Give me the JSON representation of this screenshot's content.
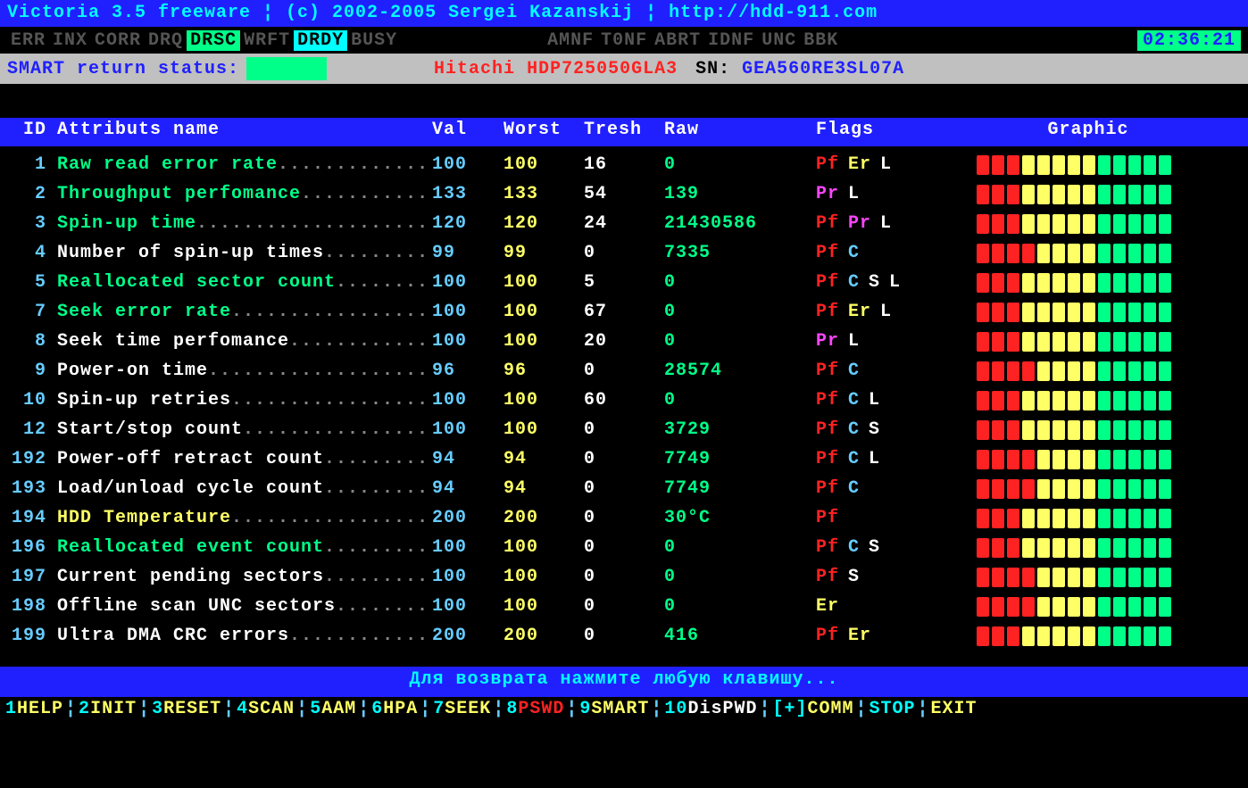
{
  "title": "Victoria 3.5 freeware  ¦  (c) 2002-2005  Sergei Kazanskij ¦ http://hdd-911.com",
  "flags_row": {
    "items": [
      "ERR",
      "INX",
      "CORR",
      "DRQ",
      "DRSC",
      "WRFT",
      "DRDY",
      "BUSY"
    ],
    "right_items": [
      "AMNF",
      "T0NF",
      "ABRT",
      "IDNF",
      "UNC",
      "BBK"
    ],
    "clock": "02:36:21"
  },
  "info": {
    "smart_label": "SMART return status:",
    "model": "Hitachi HDP725050GLA3",
    "sn_label": "SN:",
    "serial": "GEA560RE3SL07A"
  },
  "headers": {
    "id": "ID",
    "name": "Attributs name",
    "val": "Val",
    "worst": "Worst",
    "tresh": "Tresh",
    "raw": "Raw",
    "flags": "Flags",
    "graphic": "Graphic"
  },
  "rows": [
    {
      "id": "1",
      "name": "Raw read error rate",
      "style": "green",
      "val": "100",
      "worst": "100",
      "tresh": "16",
      "raw": "0",
      "flags": [
        [
          "Pf",
          "f-pf"
        ],
        [
          "Er",
          "f-er"
        ],
        [
          "L",
          "f-l"
        ]
      ],
      "bars": "rrryyyyyggggg"
    },
    {
      "id": "2",
      "name": "Throughput perfomance",
      "style": "green",
      "val": "133",
      "worst": "133",
      "tresh": "54",
      "raw": "139",
      "flags": [
        [
          "Pr",
          "f-pr"
        ],
        [
          "L",
          "f-l"
        ]
      ],
      "bars": "rrryyyyyggggg"
    },
    {
      "id": "3",
      "name": "Spin-up time",
      "style": "green",
      "val": "120",
      "worst": "120",
      "tresh": "24",
      "raw": "21430586",
      "flags": [
        [
          "Pf",
          "f-pf"
        ],
        [
          "Pr",
          "f-pr"
        ],
        [
          "L",
          "f-l"
        ]
      ],
      "bars": "rrryyyyyggggg"
    },
    {
      "id": "4",
      "name": "Number of spin-up times",
      "style": "white",
      "val": "99",
      "worst": "99",
      "tresh": "0",
      "raw": "7335",
      "flags": [
        [
          "Pf",
          "f-pf"
        ],
        [
          "C",
          "f-c"
        ]
      ],
      "bars": "rrrryyyyggggg"
    },
    {
      "id": "5",
      "name": "Reallocated sector count",
      "style": "green",
      "val": "100",
      "worst": "100",
      "tresh": "5",
      "raw": "0",
      "flags": [
        [
          "Pf",
          "f-pf"
        ],
        [
          "C",
          "f-c"
        ],
        [
          "S",
          "f-s"
        ],
        [
          "L",
          "f-l"
        ]
      ],
      "bars": "rrryyyyyggggg"
    },
    {
      "id": "7",
      "name": "Seek error rate",
      "style": "green",
      "val": "100",
      "worst": "100",
      "tresh": "67",
      "raw": "0",
      "flags": [
        [
          "Pf",
          "f-pf"
        ],
        [
          "Er",
          "f-er"
        ],
        [
          "L",
          "f-l"
        ]
      ],
      "bars": "rrryyyyyggggg"
    },
    {
      "id": "8",
      "name": "Seek time perfomance",
      "style": "white",
      "val": "100",
      "worst": "100",
      "tresh": "20",
      "raw": "0",
      "flags": [
        [
          "Pr",
          "f-pr"
        ],
        [
          "L",
          "f-l"
        ]
      ],
      "bars": "rrryyyyyggggg"
    },
    {
      "id": "9",
      "name": "Power-on time",
      "style": "white",
      "val": "96",
      "worst": "96",
      "tresh": "0",
      "raw": "28574",
      "flags": [
        [
          "Pf",
          "f-pf"
        ],
        [
          "C",
          "f-c"
        ]
      ],
      "bars": "rrrryyyyggggg"
    },
    {
      "id": "10",
      "name": "Spin-up retries",
      "style": "white",
      "val": "100",
      "worst": "100",
      "tresh": "60",
      "raw": "0",
      "flags": [
        [
          "Pf",
          "f-pf"
        ],
        [
          "C",
          "f-c"
        ],
        [
          "L",
          "f-l"
        ]
      ],
      "bars": "rrryyyyyggggg"
    },
    {
      "id": "12",
      "name": "Start/stop count",
      "style": "white",
      "val": "100",
      "worst": "100",
      "tresh": "0",
      "raw": "3729",
      "flags": [
        [
          "Pf",
          "f-pf"
        ],
        [
          "C",
          "f-c"
        ],
        [
          "S",
          "f-s"
        ]
      ],
      "bars": "rrryyyyyggggg"
    },
    {
      "id": "192",
      "name": "Power-off retract count",
      "style": "white",
      "val": "94",
      "worst": "94",
      "tresh": "0",
      "raw": "7749",
      "flags": [
        [
          "Pf",
          "f-pf"
        ],
        [
          "C",
          "f-c"
        ],
        [
          "L",
          "f-l"
        ]
      ],
      "bars": "rrrryyyyggggg"
    },
    {
      "id": "193",
      "name": "Load/unload cycle count",
      "style": "white",
      "val": "94",
      "worst": "94",
      "tresh": "0",
      "raw": "7749",
      "flags": [
        [
          "Pf",
          "f-pf"
        ],
        [
          "C",
          "f-c"
        ]
      ],
      "bars": "rrrryyyyggggg"
    },
    {
      "id": "194",
      "name": "HDD Temperature",
      "style": "yellow",
      "val": "200",
      "worst": "200",
      "tresh": "0",
      "raw": "30°C",
      "flags": [
        [
          "Pf",
          "f-pf"
        ]
      ],
      "bars": "rrryyyyyggggg"
    },
    {
      "id": "196",
      "name": "Reallocated event count",
      "style": "green",
      "val": "100",
      "worst": "100",
      "tresh": "0",
      "raw": "0",
      "flags": [
        [
          "Pf",
          "f-pf"
        ],
        [
          "C",
          "f-c"
        ],
        [
          "S",
          "f-s"
        ]
      ],
      "bars": "rrryyyyyggggg"
    },
    {
      "id": "197",
      "name": "Current pending sectors",
      "style": "white",
      "val": "100",
      "worst": "100",
      "tresh": "0",
      "raw": "0",
      "flags": [
        [
          "Pf",
          "f-pf"
        ],
        [
          "S",
          "f-s"
        ]
      ],
      "bars": "rrrryyyyggggg"
    },
    {
      "id": "198",
      "name": "Offline scan UNC sectors",
      "style": "white",
      "val": "100",
      "worst": "100",
      "tresh": "0",
      "raw": "0",
      "flags": [
        [
          "Er",
          "f-er"
        ]
      ],
      "bars": "rrrryyyyggggg"
    },
    {
      "id": "199",
      "name": "Ultra DMA CRC errors",
      "style": "white",
      "val": "200",
      "worst": "200",
      "tresh": "0",
      "raw": "416",
      "flags": [
        [
          "Pf",
          "f-pf"
        ],
        [
          "Er",
          "f-er"
        ]
      ],
      "bars": "rrryyyyyggggg"
    }
  ],
  "prompt": "Для возврата нажмите любую клавишу...",
  "menu": [
    {
      "key": "1",
      "label": "HELP"
    },
    {
      "key": "2",
      "label": "INIT"
    },
    {
      "key": "3",
      "label": "RESET"
    },
    {
      "key": "4",
      "label": "SCAN"
    },
    {
      "key": "5",
      "label": "AAM"
    },
    {
      "key": "6",
      "label": "HPA"
    },
    {
      "key": "7",
      "label": "SEEK"
    },
    {
      "key": "8",
      "label": "PSWD",
      "cls": "mred"
    },
    {
      "key": "9",
      "label": "SMART"
    },
    {
      "key": "10",
      "label": "DisPWD",
      "cls": "mdispwd"
    },
    {
      "key": "[+]",
      "label": "COMM",
      "cls": "mcomm"
    },
    {
      "key": "",
      "label": "STOP",
      "cls": "mstop"
    },
    {
      "key": "",
      "label": "EXIT",
      "cls": "mexit"
    }
  ]
}
